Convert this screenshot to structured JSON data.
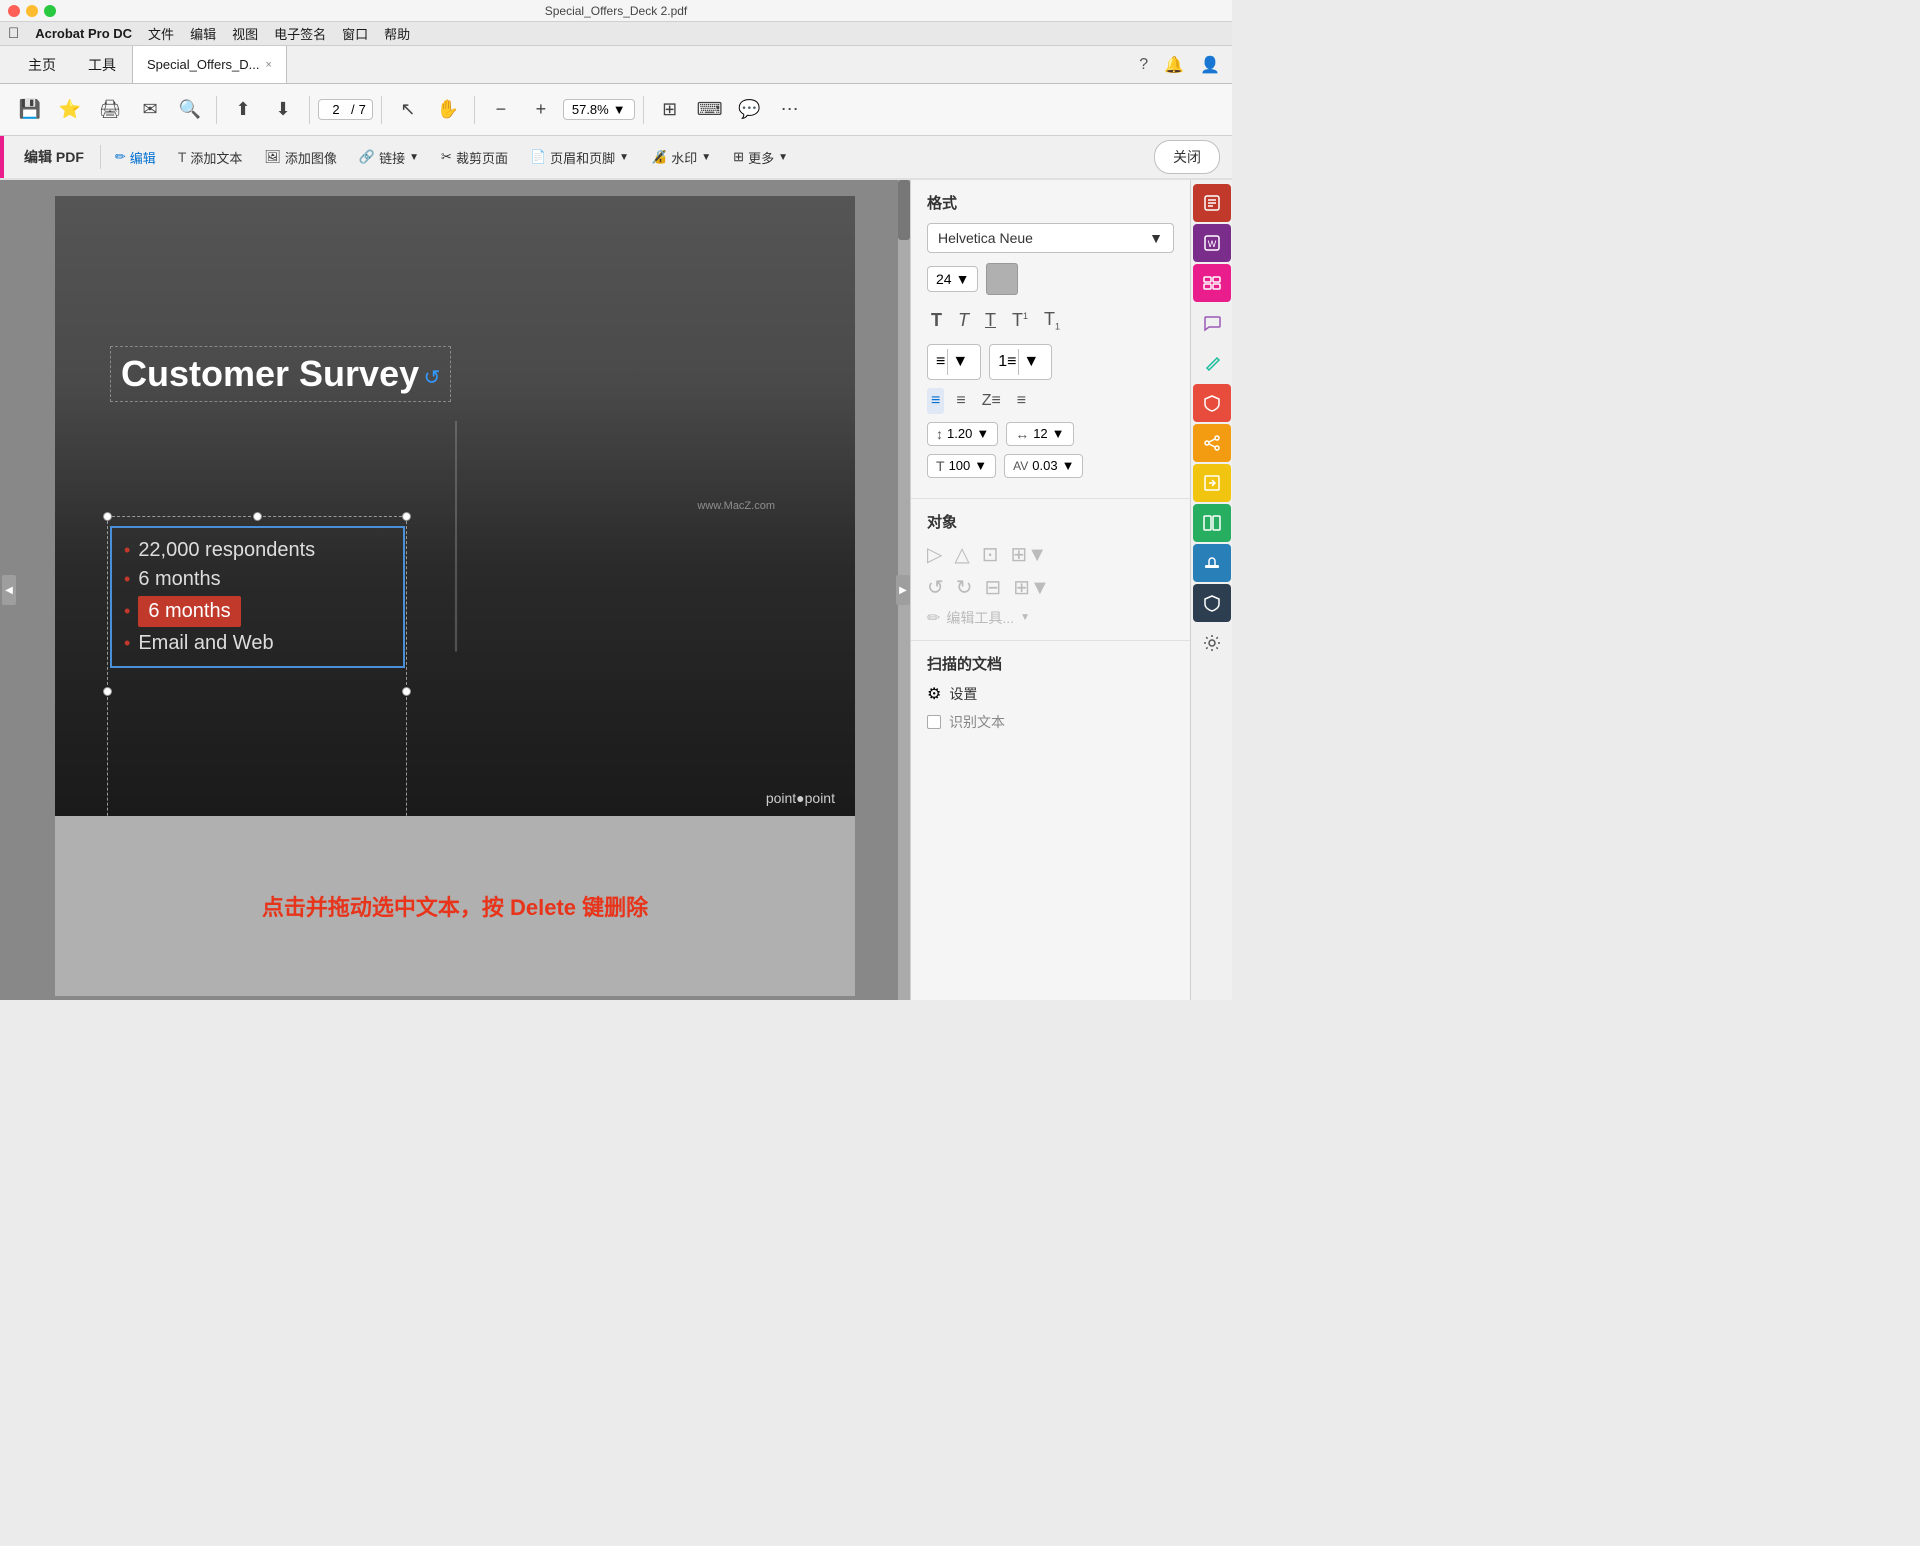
{
  "window": {
    "title": "Special_Offers_Deck 2.pdf",
    "traffic_lights": [
      "red",
      "yellow",
      "green"
    ]
  },
  "menubar": {
    "apple": "&#63743;",
    "items": [
      "Acrobat Pro DC",
      "文件",
      "编辑",
      "视图",
      "电子签名",
      "窗口",
      "帮助"
    ]
  },
  "tabbar": {
    "home": "主页",
    "tools": "工具",
    "doc_tab": "Special_Offers_D...",
    "close": "×"
  },
  "toolbar": {
    "page_current": "2",
    "page_total": "7",
    "zoom": "57.8%"
  },
  "edit_toolbar": {
    "label": "编辑 PDF",
    "edit_btn": "编辑",
    "add_text": "添加文本",
    "add_image": "添加图像",
    "link": "链接",
    "crop": "裁剪页面",
    "header_footer": "页眉和页脚",
    "watermark": "水印",
    "more": "更多",
    "close": "关闭"
  },
  "pdf": {
    "survey_title": "Customer Survey",
    "bullets": [
      "22,000 respondents",
      "6 months",
      "6 months",
      "Email and Web"
    ],
    "selected_bullet": "6 months",
    "bottom_text": "点击并拖动选中文本，按 Delete 键删除",
    "logo": "point●point"
  },
  "right_panel": {
    "format_title": "格式",
    "font_name": "Helvetica Neue",
    "font_size": "24",
    "format_icons": [
      "T",
      "T̲",
      "T̈",
      "T¹",
      "T₁"
    ],
    "line_spacing": "1.20",
    "char_spacing": "12",
    "scale": "100",
    "kerning": "0.03",
    "object_title": "对象",
    "scan_title": "扫描的文档",
    "scan_settings": "设置",
    "recognize_text": "识别文本"
  }
}
